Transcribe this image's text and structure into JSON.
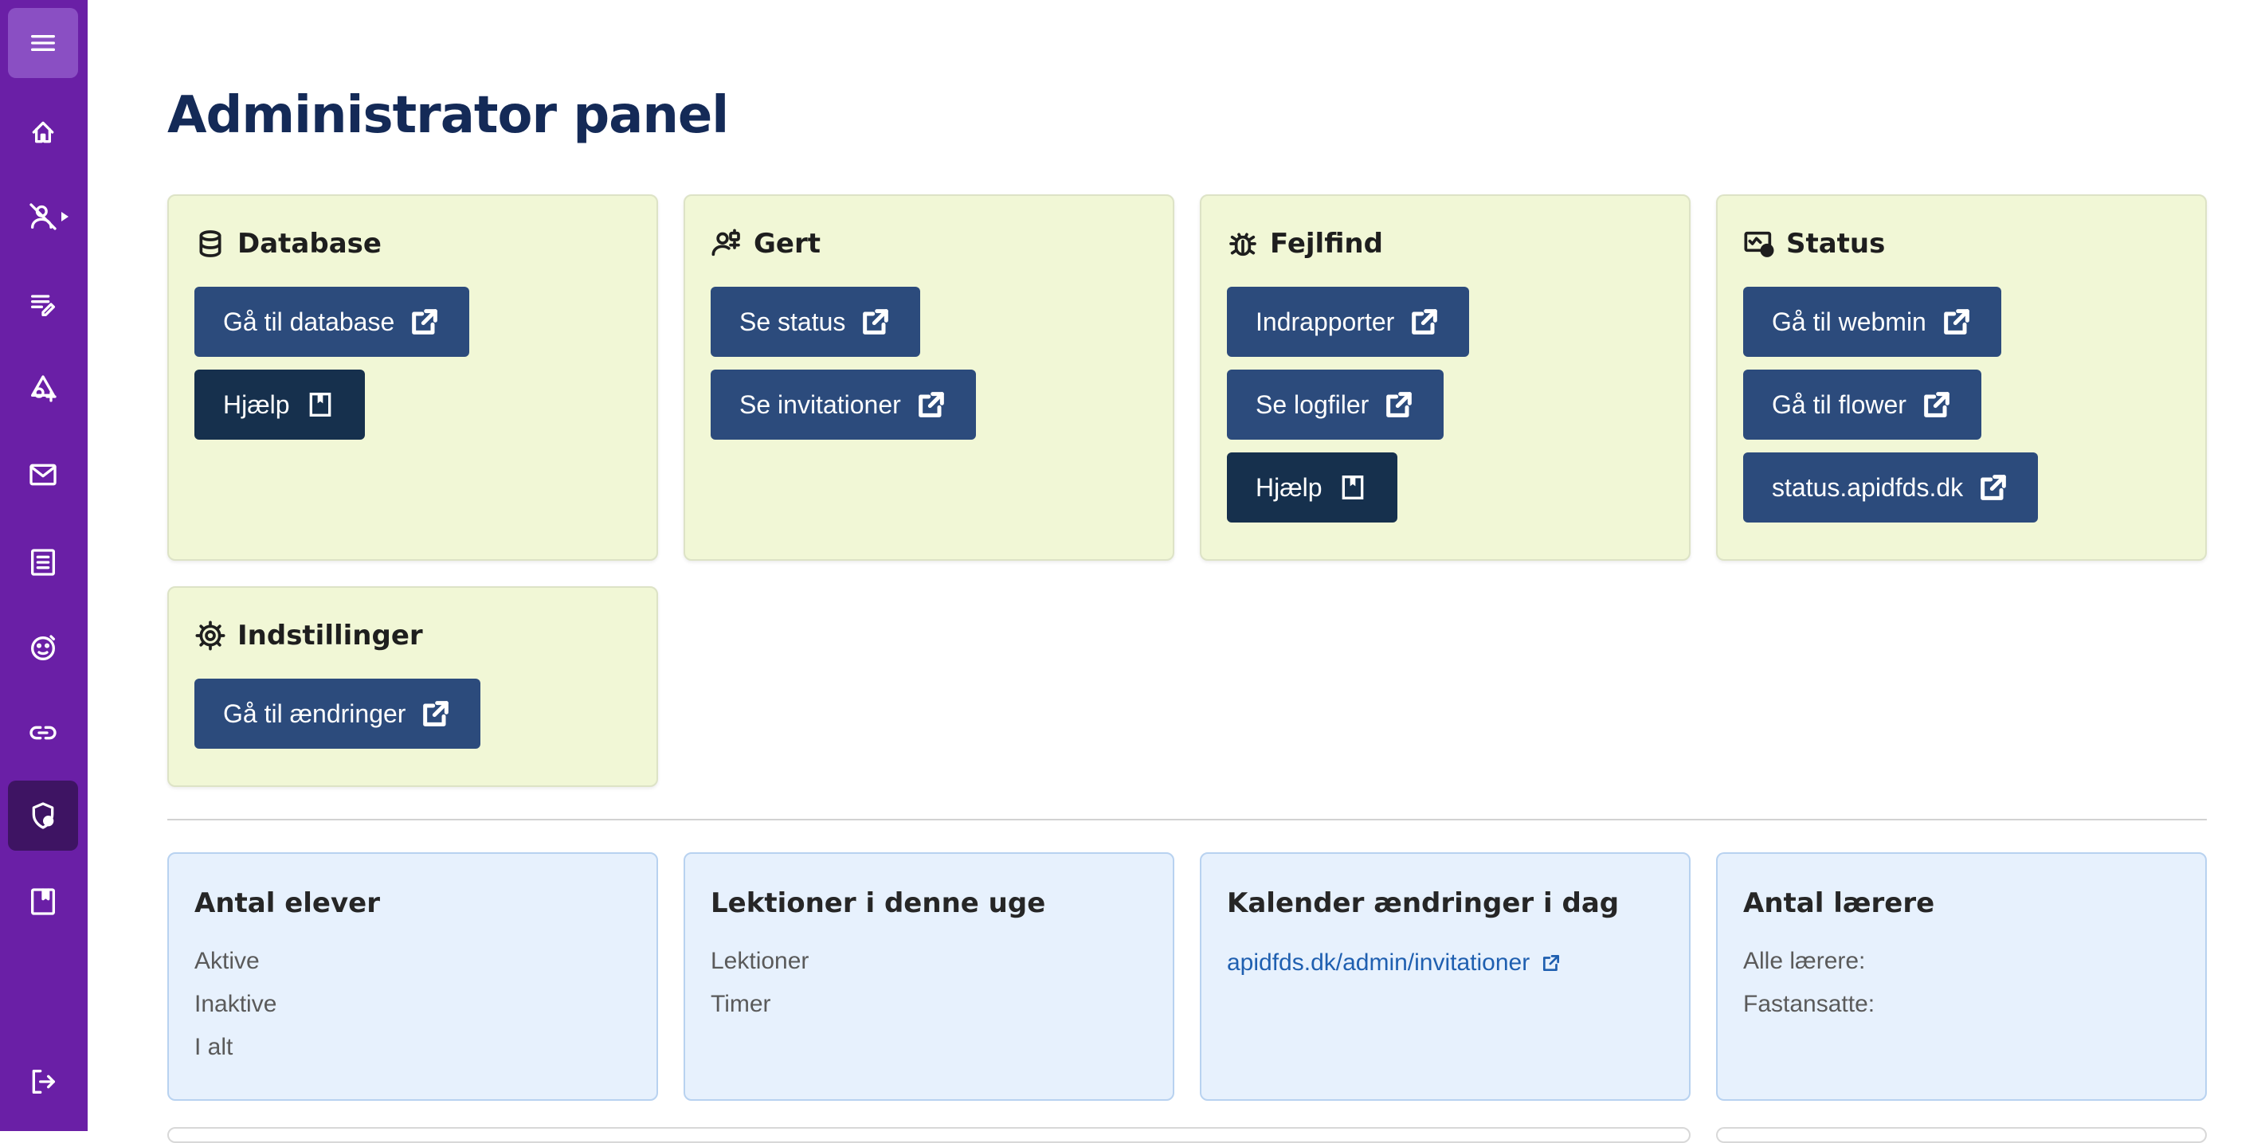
{
  "page": {
    "title": "Administrator panel"
  },
  "colors": {
    "sidebar": "#6a1fa6",
    "title": "#142a57",
    "button": "#2c4b7c",
    "button_dark": "#16304d",
    "card_green": "#f1f7d6",
    "card_blue": "#e7f1fd",
    "link": "#1f5fb0"
  },
  "sidebar": {
    "items": [
      {
        "icon": "menu-icon"
      },
      {
        "icon": "home-icon"
      },
      {
        "icon": "user-off-icon"
      },
      {
        "icon": "list-edit-icon"
      },
      {
        "icon": "shapes-add-icon"
      },
      {
        "icon": "mail-icon"
      },
      {
        "icon": "list-details-icon"
      },
      {
        "icon": "face-icon"
      },
      {
        "icon": "link-icon"
      },
      {
        "icon": "shield-person-icon",
        "active": true
      },
      {
        "icon": "book-icon"
      },
      {
        "icon": "logout-icon"
      }
    ]
  },
  "admin_cards": {
    "database": {
      "title": "Database",
      "icon": "database-icon",
      "buttons": [
        "Gå til database",
        "Hjælp"
      ]
    },
    "gert": {
      "title": "Gert",
      "icon": "robot-person-icon",
      "buttons": [
        "Se status",
        "Se invitationer"
      ]
    },
    "fejlfind": {
      "title": "Fejlfind",
      "icon": "bug-icon",
      "buttons": [
        "Indrapporter",
        "Se logfiler",
        "Hjælp"
      ]
    },
    "status": {
      "title": "Status",
      "icon": "monitor-check-icon",
      "buttons": [
        "Gå til webmin",
        "Gå til flower",
        "status.apidfds.dk"
      ]
    },
    "indstillinger": {
      "title": "Indstillinger",
      "icon": "gear-icon",
      "buttons": [
        "Gå til ændringer"
      ]
    }
  },
  "stat_cards": {
    "elever": {
      "title": "Antal elever",
      "lines": [
        "Aktive",
        "Inaktive",
        "I alt"
      ]
    },
    "lektioner": {
      "title": "Lektioner i denne uge",
      "lines": [
        "Lektioner",
        "Timer"
      ]
    },
    "kalender": {
      "title": "Kalender ændringer i dag",
      "link": "apidfds.dk/admin/invitationer"
    },
    "laerere": {
      "title": "Antal lærere",
      "lines": [
        "Alle lærere:",
        "Fastansatte:"
      ]
    }
  }
}
